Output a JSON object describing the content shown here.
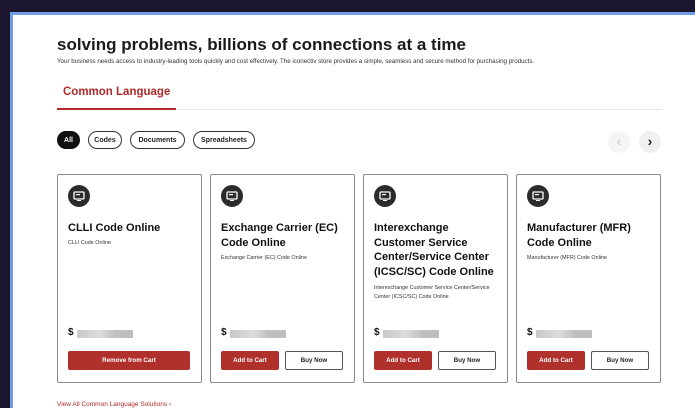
{
  "hero": {
    "headline": "solving problems, billions of connections at a time",
    "subline": "Your business needs access to industry-leading tools quickly and cost effectively. The iconectiv store provides a simple, seamless and secure method for purchasing products."
  },
  "tabs": [
    {
      "label": "Common Language",
      "active": true
    }
  ],
  "filters": [
    {
      "label": "All",
      "active": true
    },
    {
      "label": "Codes",
      "active": false
    },
    {
      "label": "Documents",
      "active": false
    },
    {
      "label": "Spreadsheets",
      "active": false
    }
  ],
  "carousel": {
    "prev_symbol": "‹",
    "next_symbol": "›"
  },
  "products": [
    {
      "icon": "monitor-icon",
      "title": "CLLI Code Online",
      "description": "CLLI Code Online",
      "currency": "$",
      "price_obscured": true,
      "primary_button": "Remove from Cart",
      "secondary_button": ""
    },
    {
      "icon": "monitor-icon",
      "title": "Exchange Carrier (EC) Code Online",
      "description": "Exchange Carrier (EC) Code Online",
      "currency": "$",
      "price_obscured": true,
      "primary_button": "Add to Cart",
      "secondary_button": "Buy Now"
    },
    {
      "icon": "monitor-icon",
      "title": "Interexchange Customer Service Center/Service Center (ICSC/SC) Code Online",
      "description": "Interexchange Customer Service Center/Service Center (ICSC/SC) Code Online",
      "currency": "$",
      "price_obscured": true,
      "primary_button": "Add to Cart",
      "secondary_button": "Buy Now"
    },
    {
      "icon": "monitor-icon",
      "title": "Manufacturer (MFR) Code Online",
      "description": "Manufacturer (MFR) Code Online",
      "currency": "$",
      "price_obscured": true,
      "primary_button": "Add to Cart",
      "secondary_button": "Buy Now"
    }
  ],
  "footer_link": "View All Common Language Solutions  ›",
  "colors": {
    "accent": "#b0302b",
    "frame_border": "#6f9ee6",
    "background_outer": "#1c1530"
  }
}
